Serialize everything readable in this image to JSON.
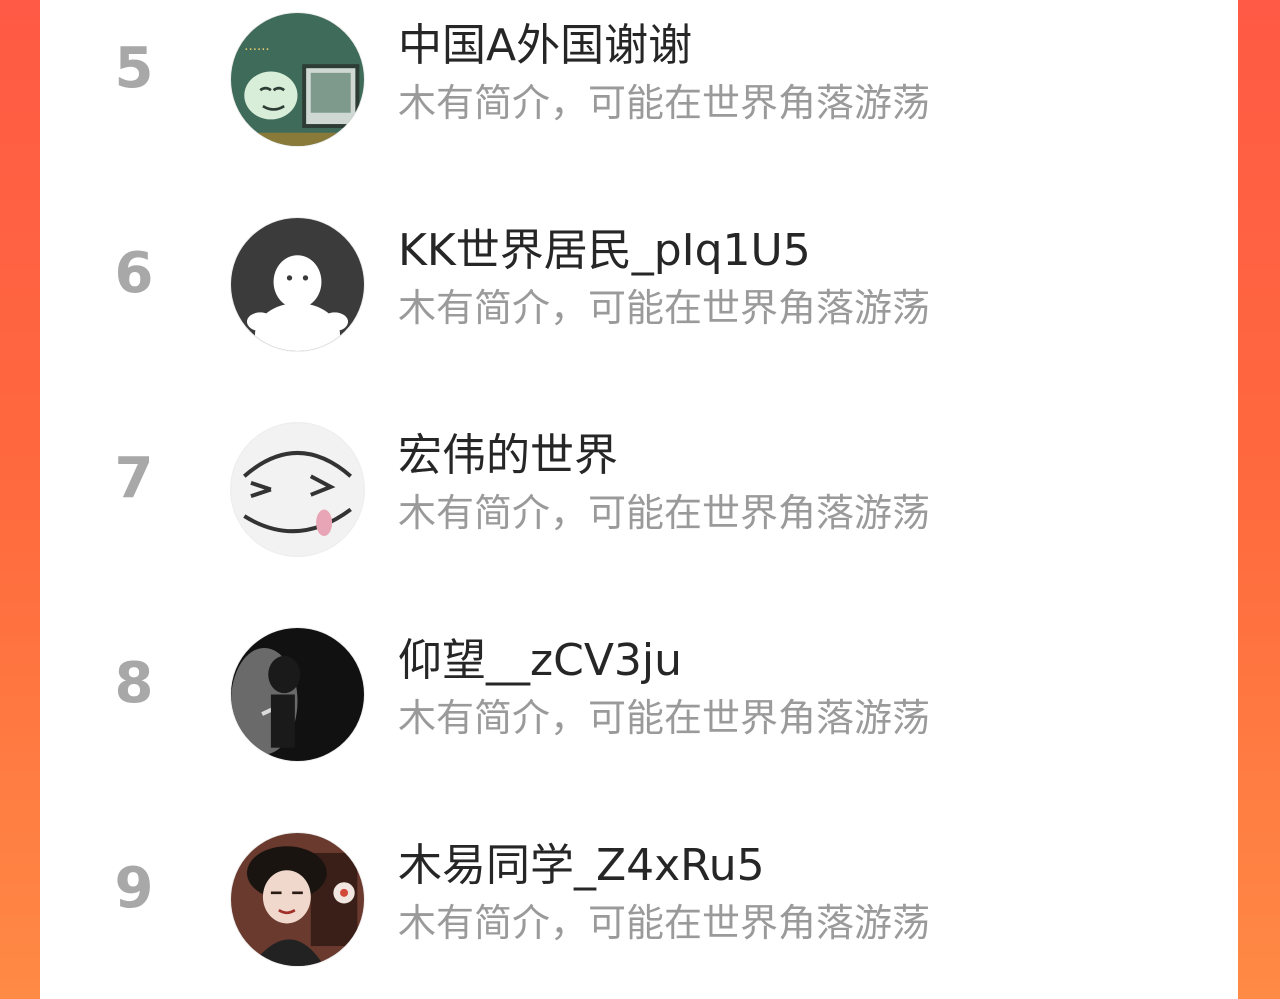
{
  "ranking": {
    "items": [
      {
        "rank": "5",
        "name": "中国A外国谢谢",
        "bio": "木有简介，可能在世界角落游荡",
        "avatar_icon": "meme-face-computer-avatar-icon"
      },
      {
        "rank": "6",
        "name": "KK世界居民_pIq1U5",
        "bio": "木有简介，可能在世界角落游荡",
        "avatar_icon": "default-white-figure-avatar-icon"
      },
      {
        "rank": "7",
        "name": "宏伟的世界",
        "bio": "木有简介，可能在世界角落游荡",
        "avatar_icon": "sketch-smiling-face-avatar-icon"
      },
      {
        "rank": "8",
        "name": "仰望__zCV3ju",
        "bio": "木有简介，可能在世界角落游荡",
        "avatar_icon": "silhouette-smoking-avatar-icon"
      },
      {
        "rank": "9",
        "name": "木易同学_Z4xRu5",
        "bio": "木有简介，可能在世界角落游荡",
        "avatar_icon": "anime-character-avatar-icon"
      }
    ]
  },
  "colors": {
    "background_gradient_start": "#ff5a45",
    "background_gradient_end": "#ff8a45",
    "panel": "#ffffff",
    "rank_text": "#a8a8a8",
    "name_text": "#262626",
    "bio_text": "#9a9a9a"
  }
}
